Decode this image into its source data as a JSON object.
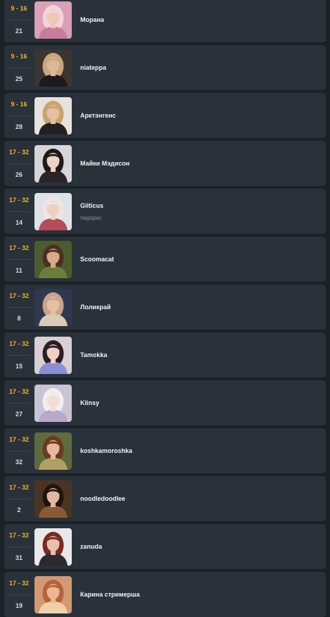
{
  "streamers": [
    {
      "range": "9 - 16",
      "number": "21",
      "name": "Морана",
      "subtitle": "",
      "avatar_icon": "streamer-photo-icon",
      "bg": "#d9a0b6",
      "hair": "#f3d2df",
      "skin": "#f0c7b4",
      "cloth": "#c97c9b"
    },
    {
      "range": "9 - 16",
      "number": "25",
      "name": "niateppa",
      "subtitle": "",
      "avatar_icon": "streamer-photo-icon",
      "bg": "#3b3430",
      "hair": "#c9a77b",
      "skin": "#dcb79d",
      "cloth": "#1c1a1a"
    },
    {
      "range": "9 - 16",
      "number": "28",
      "name": "Арктэнгенс",
      "subtitle": "",
      "avatar_icon": "streamer-photo-icon",
      "bg": "#e6e2dd",
      "hair": "#c9a36a",
      "skin": "#e4c0a6",
      "cloth": "#222021"
    },
    {
      "range": "17 - 32",
      "number": "26",
      "name": "Майки Мэдисон",
      "subtitle": "",
      "avatar_icon": "streamer-photo-icon",
      "bg": "#d6d6d9",
      "hair": "#1f1a1a",
      "skin": "#edd3c4",
      "cloth": "#2a2628"
    },
    {
      "range": "17 - 32",
      "number": "14",
      "name": "Gilticus",
      "subtitle": "пидорас",
      "avatar_icon": "streamer-photo-icon",
      "bg": "#dde3e8",
      "hair": "#ede6e4",
      "skin": "#efd1c1",
      "cloth": "#b44c5a"
    },
    {
      "range": "17 - 32",
      "number": "11",
      "name": "Scoomacat",
      "subtitle": "",
      "avatar_icon": "streamer-photo-icon",
      "bg": "#4d5c2e",
      "hair": "#4b3022",
      "skin": "#d9a98a",
      "cloth": "#6d7d3c"
    },
    {
      "range": "17 - 32",
      "number": "8",
      "name": "Лоликрай",
      "subtitle": "",
      "avatar_icon": "streamer-photo-icon",
      "bg": "#2f3850",
      "hair": "#c8a589",
      "skin": "#e5c1a4",
      "cloth": "#d9cbb8"
    },
    {
      "range": "17 - 32",
      "number": "15",
      "name": "Tamokka",
      "subtitle": "",
      "avatar_icon": "streamer-photo-icon",
      "bg": "#d9cfd4",
      "hair": "#2a1e22",
      "skin": "#efd0c3",
      "cloth": "#8d8fd6"
    },
    {
      "range": "17 - 32",
      "number": "27",
      "name": "Klinsy",
      "subtitle": "",
      "avatar_icon": "streamer-photo-icon",
      "bg": "#c9c3d6",
      "hair": "#f1eef0",
      "skin": "#f3dcd8",
      "cloth": "#b8a8c9"
    },
    {
      "range": "17 - 32",
      "number": "32",
      "name": "koshkamoroshka",
      "subtitle": "",
      "avatar_icon": "streamer-photo-icon",
      "bg": "#5e6b3d",
      "hair": "#6a3a23",
      "skin": "#e8b99a",
      "cloth": "#b0a061"
    },
    {
      "range": "17 - 32",
      "number": "2",
      "name": "noodledoodlee",
      "subtitle": "",
      "avatar_icon": "streamer-photo-icon",
      "bg": "#4b3522",
      "hair": "#1f1412",
      "skin": "#e3b79e",
      "cloth": "#8a5a36"
    },
    {
      "range": "17 - 32",
      "number": "31",
      "name": "zanuda",
      "subtitle": "",
      "avatar_icon": "streamer-photo-icon",
      "bg": "#e9e9ea",
      "hair": "#7a2a22",
      "skin": "#e6c2ac",
      "cloth": "#2b2b2d"
    },
    {
      "range": "17 - 32",
      "number": "19",
      "name": "Карина стримерша",
      "subtitle": "",
      "avatar_icon": "streamer-photo-icon",
      "bg": "#d19a72",
      "hair": "#b5623a",
      "skin": "#eab892",
      "cloth": "#f0d0a8"
    }
  ]
}
